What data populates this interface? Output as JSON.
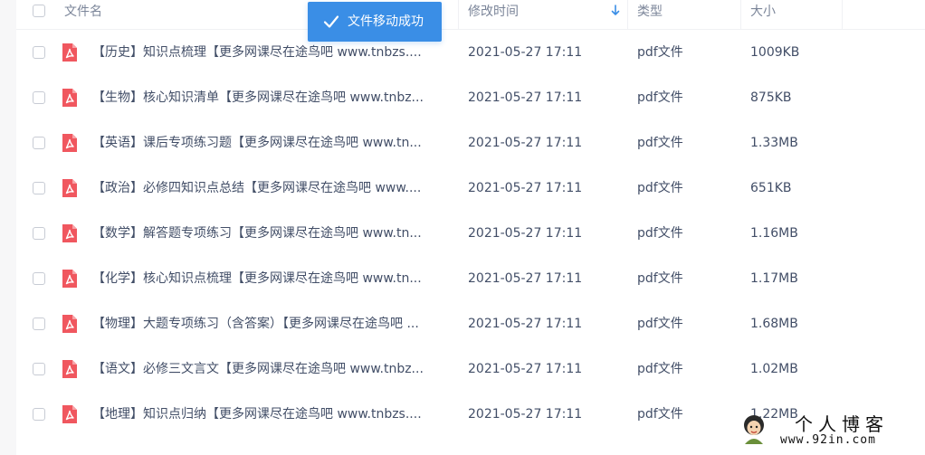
{
  "header": {
    "col_name": "文件名",
    "col_modified": "修改时间",
    "col_type": "类型",
    "col_size": "大小"
  },
  "toast": {
    "message": "文件移动成功"
  },
  "files": [
    {
      "name": "【历史】知识点梳理【更多网课尽在途鸟吧 www.tnbzs....",
      "modified": "2021-05-27 17:11",
      "type": "pdf文件",
      "size": "1009KB"
    },
    {
      "name": "【生物】核心知识清单【更多网课尽在途鸟吧 www.tnbz...",
      "modified": "2021-05-27 17:11",
      "type": "pdf文件",
      "size": "875KB"
    },
    {
      "name": "【英语】课后专项练习题【更多网课尽在途鸟吧 www.tn...",
      "modified": "2021-05-27 17:11",
      "type": "pdf文件",
      "size": "1.33MB"
    },
    {
      "name": "【政治】必修四知识点总结【更多网课尽在途鸟吧 www....",
      "modified": "2021-05-27 17:11",
      "type": "pdf文件",
      "size": "651KB"
    },
    {
      "name": "【数学】解答题专项练习【更多网课尽在途鸟吧 www.tn...",
      "modified": "2021-05-27 17:11",
      "type": "pdf文件",
      "size": "1.16MB"
    },
    {
      "name": "【化学】核心知识点梳理【更多网课尽在途鸟吧 www.tn...",
      "modified": "2021-05-27 17:11",
      "type": "pdf文件",
      "size": "1.17MB"
    },
    {
      "name": "【物理】大题专项练习（含答案）【更多网课尽在途鸟吧 ...",
      "modified": "2021-05-27 17:11",
      "type": "pdf文件",
      "size": "1.68MB"
    },
    {
      "name": "【语文】必修三文言文【更多网课尽在途鸟吧 www.tnbz...",
      "modified": "2021-05-27 17:11",
      "type": "pdf文件",
      "size": "1.02MB"
    },
    {
      "name": "【地理】知识点归纳【更多网课尽在途鸟吧 www.tnbzs....",
      "modified": "2021-05-27 17:11",
      "type": "pdf文件",
      "size": "1.22MB"
    }
  ],
  "watermark": {
    "title": "个人博客",
    "url": "www.92in.com"
  },
  "colors": {
    "accent": "#3a8ee6",
    "pdf_icon": "#f0575f"
  }
}
